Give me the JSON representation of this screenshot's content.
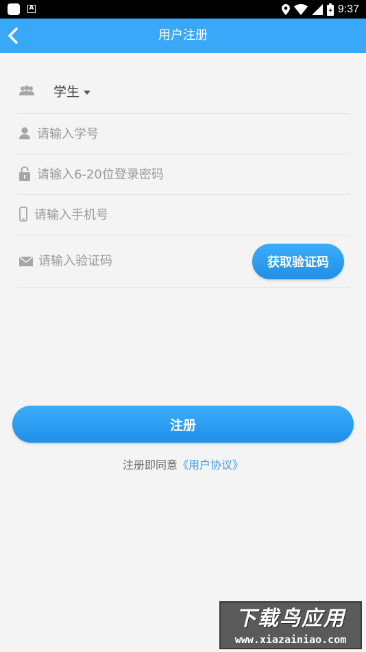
{
  "status_bar": {
    "time": "9:37"
  },
  "header": {
    "title": "用户注册"
  },
  "form": {
    "role": {
      "selected": "学生"
    },
    "student_id": {
      "placeholder": "请输入学号",
      "value": ""
    },
    "password": {
      "placeholder": "请输入6-20位登录密码",
      "value": ""
    },
    "phone": {
      "placeholder": "请输入手机号",
      "value": ""
    },
    "code": {
      "placeholder": "请输入验证码",
      "value": "",
      "button_label": "获取验证码"
    }
  },
  "register_button": {
    "label": "注册"
  },
  "agreement": {
    "prefix": "注册即同意",
    "link_text": "《用户协议》"
  },
  "watermark": {
    "title": "下载鸟应用",
    "url": "www.xiazainiao.com"
  },
  "colors": {
    "primary": "#3aa8f8",
    "link": "#3a9ef0",
    "background": "#f4f4f4"
  }
}
